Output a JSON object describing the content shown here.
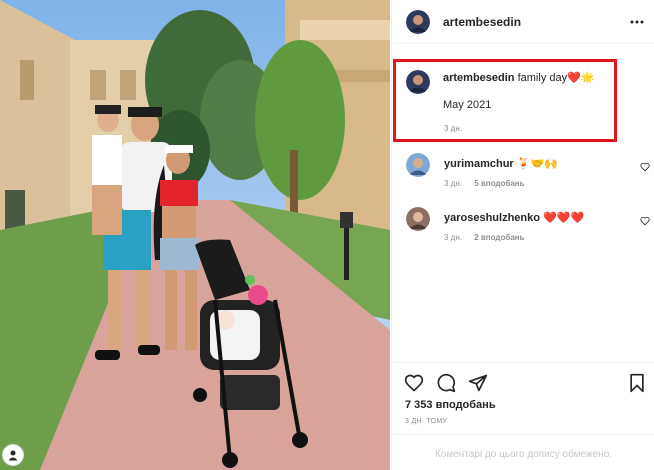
{
  "post": {
    "author": "artembesedin",
    "caption_text": "family day",
    "caption_emoji": "❤️🌟",
    "caption_line2": "May 2021",
    "caption_time": "3 дн."
  },
  "comments": [
    {
      "username": "yurimamchur",
      "text": "🍹🤝🙌",
      "time": "3 дн.",
      "likes": "5 вподобань"
    },
    {
      "username": "yaroseshulzhenko",
      "text": "❤️❤️❤️",
      "time": "3 дн.",
      "likes": "2 вподобань"
    }
  ],
  "likes_total": "7 353 вподобань",
  "posted_ago": "3 ДН. ТОМУ",
  "comments_disabled": "Коментарі до цього допису обмежено.",
  "icons": [
    "more-icon",
    "heart-icon",
    "comment-icon",
    "share-icon",
    "bookmark-icon",
    "user-icon"
  ],
  "colors": {
    "highlight": "#e0151b",
    "muted": "#8e8e8e",
    "text": "#262626"
  }
}
